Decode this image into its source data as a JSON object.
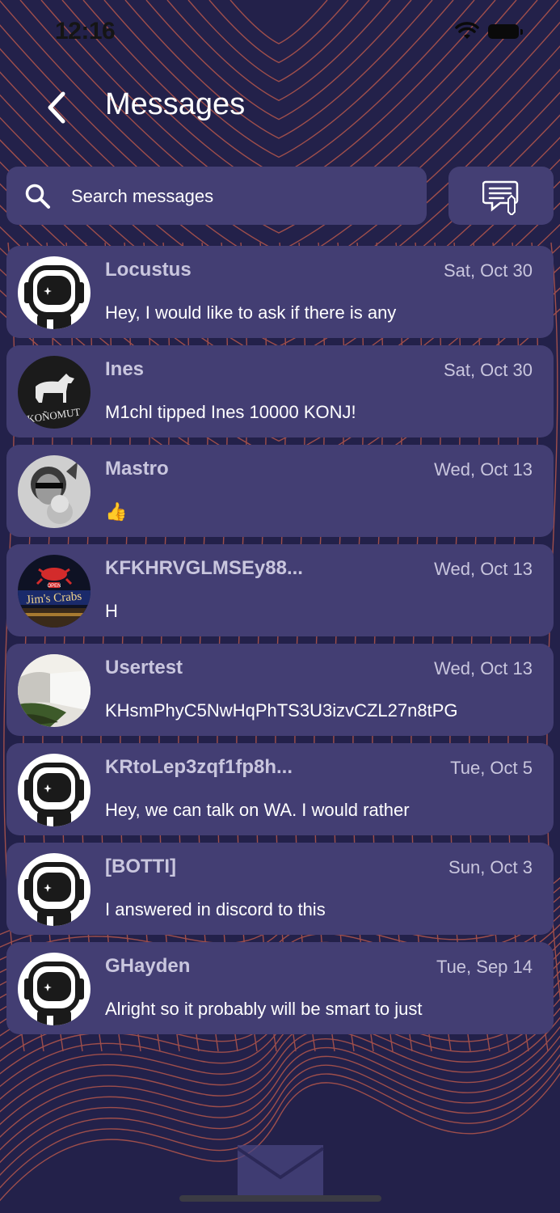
{
  "status_bar": {
    "time": "12:16"
  },
  "header": {
    "title": "Messages"
  },
  "search": {
    "placeholder": "Search messages"
  },
  "conversations": [
    {
      "name": "Locustus",
      "date": "Sat, Oct 30",
      "preview": "Hey, I would like to ask if there is any",
      "avatar": "astronaut-avatar"
    },
    {
      "name": "Ines",
      "date": "Sat, Oct 30",
      "preview": "M1chl tipped Ines 10000 KONJ!",
      "avatar": "horse-logo-avatar"
    },
    {
      "name": "Mastro",
      "date": "Wed, Oct 13",
      "preview": "👍",
      "avatar": "photo-avatar"
    },
    {
      "name": "KFKHRVGLMSEy88...",
      "date": "Wed, Oct 13",
      "preview": "H",
      "avatar": "crab-sign-avatar"
    },
    {
      "name": "Usertest",
      "date": "Wed, Oct 13",
      "preview": "KHsmPhyC5NwHqPhTS3U3izvCZL27n8tPG",
      "avatar": "waterfall-avatar"
    },
    {
      "name": "KRtoLep3zqf1fp8h...",
      "date": "Tue, Oct 5",
      "preview": "Hey, we can talk on WA. I would rather",
      "avatar": "astronaut-avatar"
    },
    {
      "name": "[BOTTI]",
      "date": "Sun, Oct 3",
      "preview": "I answered in discord to this",
      "avatar": "astronaut-avatar"
    },
    {
      "name": "GHayden",
      "date": "Tue, Sep 14",
      "preview": "Alright so it probably will be smart to just",
      "avatar": "astronaut-avatar"
    }
  ],
  "avatar_text": {
    "horse_logo": "KOÑOMUT",
    "crab_sign": "Jim's Crabs",
    "crab_sign_small": "OPEN"
  },
  "icons": {
    "back": "chevron-left-icon",
    "search": "search-icon",
    "compose": "compose-message-icon",
    "mail": "mail-envelope-icon"
  },
  "colors": {
    "background": "#23214a",
    "card": "#433e73",
    "accent_lines": "#d0634f",
    "text_primary": "#ffffff",
    "text_secondary": "#c9c6de"
  }
}
